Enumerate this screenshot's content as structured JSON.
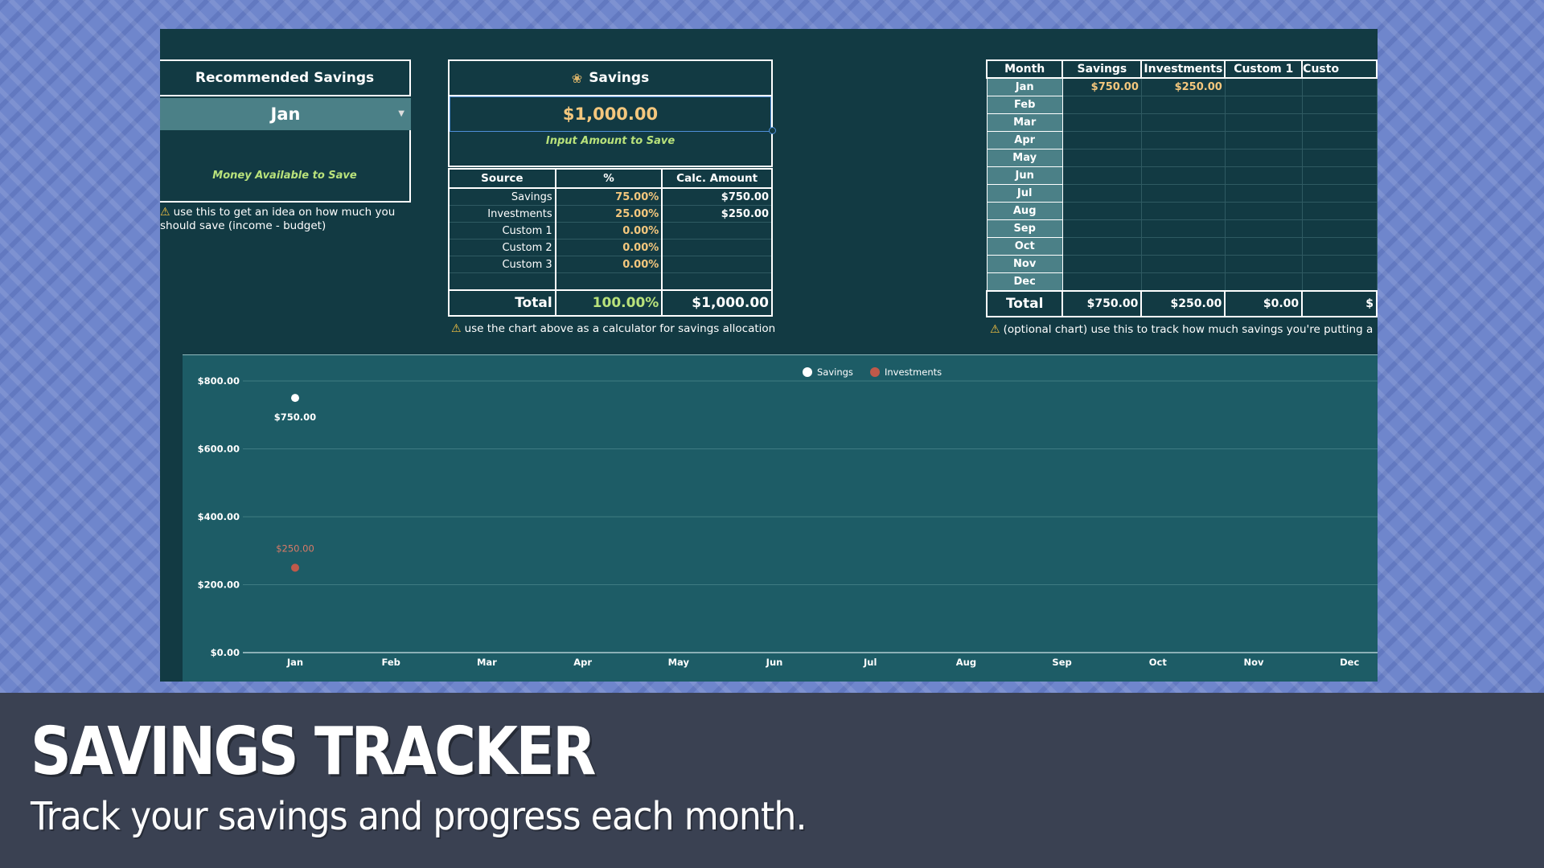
{
  "recommended": {
    "title": "Recommended Savings",
    "selected_month": "Jan",
    "money_label": "Money Available to Save",
    "note": "use this to get an idea on how much you should save (income - budget)"
  },
  "savings_calc": {
    "icon": "money-bag-icon",
    "title": "Savings",
    "input_amount": "$1,000.00",
    "input_label": "Input Amount to Save",
    "headers": [
      "Source",
      "%",
      "Calc. Amount"
    ],
    "rows": [
      {
        "source": "Savings",
        "pct": "75.00%",
        "amount": "$750.00"
      },
      {
        "source": "Investments",
        "pct": "25.00%",
        "amount": "$250.00"
      },
      {
        "source": "Custom 1",
        "pct": "0.00%",
        "amount": ""
      },
      {
        "source": "Custom 2",
        "pct": "0.00%",
        "amount": ""
      },
      {
        "source": "Custom 3",
        "pct": "0.00%",
        "amount": ""
      },
      {
        "source": "",
        "pct": "",
        "amount": ""
      }
    ],
    "total_label": "Total",
    "total_pct": "100.00%",
    "total_amount": "$1,000.00",
    "note": "use the chart above as a calculator for savings allocation"
  },
  "monthly": {
    "headers": [
      "Month",
      "Savings",
      "Investments",
      "Custom 1",
      "Custo"
    ],
    "rows": [
      {
        "month": "Jan",
        "savings": "$750.00",
        "investments": "$250.00"
      },
      {
        "month": "Feb",
        "savings": "",
        "investments": ""
      },
      {
        "month": "Mar",
        "savings": "",
        "investments": ""
      },
      {
        "month": "Apr",
        "savings": "",
        "investments": ""
      },
      {
        "month": "May",
        "savings": "",
        "investments": ""
      },
      {
        "month": "Jun",
        "savings": "",
        "investments": ""
      },
      {
        "month": "Jul",
        "savings": "",
        "investments": ""
      },
      {
        "month": "Aug",
        "savings": "",
        "investments": ""
      },
      {
        "month": "Sep",
        "savings": "",
        "investments": ""
      },
      {
        "month": "Oct",
        "savings": "",
        "investments": ""
      },
      {
        "month": "Nov",
        "savings": "",
        "investments": ""
      },
      {
        "month": "Dec",
        "savings": "",
        "investments": ""
      }
    ],
    "total_label": "Total",
    "total_savings": "$750.00",
    "total_investments": "$250.00",
    "total_custom1": "$0.00",
    "total_custom2_partial": "$",
    "note": "(optional chart) use this to track how much savings you're putting a"
  },
  "chart_data": {
    "type": "scatter",
    "categories": [
      "Jan",
      "Feb",
      "Mar",
      "Apr",
      "May",
      "Jun",
      "Jul",
      "Aug",
      "Sep",
      "Oct",
      "Nov",
      "Dec"
    ],
    "series": [
      {
        "name": "Savings",
        "color": "#ffffff",
        "values": [
          750,
          null,
          null,
          null,
          null,
          null,
          null,
          null,
          null,
          null,
          null,
          null
        ],
        "labels": [
          "$750.00"
        ]
      },
      {
        "name": "Investments",
        "color": "#c0594a",
        "values": [
          250,
          null,
          null,
          null,
          null,
          null,
          null,
          null,
          null,
          null,
          null,
          null
        ],
        "labels": [
          "$250.00"
        ]
      }
    ],
    "yticks": [
      "$0.00",
      "$200.00",
      "$400.00",
      "$600.00",
      "$800.00"
    ],
    "ylim": [
      0,
      800
    ],
    "legend": "top-center",
    "grid": true
  },
  "banner": {
    "title": "SAVINGS TRACKER",
    "subtitle": "Track your savings and progress each month."
  },
  "colors": {
    "panel_bg": "#123a43",
    "chart_bg": "#1d5c66",
    "accent_gold": "#f4c77d",
    "accent_green": "#b9e27b",
    "month_cell": "#4b8087"
  }
}
